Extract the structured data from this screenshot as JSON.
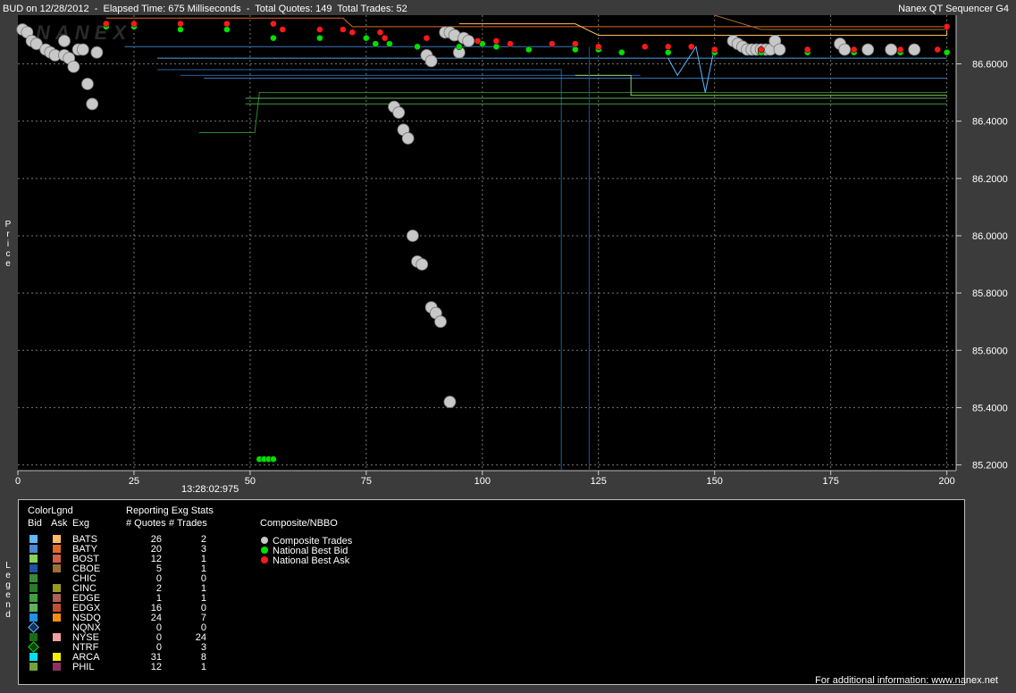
{
  "header": {
    "left": "BUD on 12/28/2012  -  Elapsed Time: 675 Milliseconds  -  Total Quotes: 149  Total Trades: 52",
    "right": "Nanex QT Sequencer G4",
    "watermark": "NANEX"
  },
  "price_axis_label": "Price",
  "legend_side_label": "Legend",
  "time_label": "13:28:02:975",
  "chart_data": {
    "type": "scatter",
    "title": "",
    "xlabel": "",
    "ylabel": "Price",
    "xlim": [
      0,
      202
    ],
    "ylim": [
      85.18,
      86.77
    ],
    "x_ticks": [
      0,
      25,
      50,
      75,
      100,
      125,
      150,
      175,
      200
    ],
    "y_ticks": [
      85.2,
      85.4,
      85.6,
      85.8,
      86.0,
      86.2,
      86.4,
      86.6
    ],
    "y_tick_labels": [
      "85.2000",
      "85.4000",
      "85.6000",
      "85.8000",
      "86.0000",
      "86.2000",
      "86.4000",
      "86.6000"
    ],
    "grid": true,
    "series": [
      {
        "name": "Composite Trades",
        "color": "#c8c8c8",
        "points": [
          [
            1,
            86.72
          ],
          [
            2,
            86.71
          ],
          [
            3,
            86.68
          ],
          [
            4,
            86.67
          ],
          [
            6,
            86.65
          ],
          [
            7,
            86.64
          ],
          [
            8,
            86.63
          ],
          [
            10,
            86.68
          ],
          [
            10,
            86.63
          ],
          [
            11,
            86.62
          ],
          [
            12,
            86.59
          ],
          [
            13,
            86.65
          ],
          [
            14,
            86.65
          ],
          [
            15,
            86.53
          ],
          [
            16,
            86.46
          ],
          [
            17,
            86.64
          ],
          [
            81,
            86.45
          ],
          [
            82,
            86.43
          ],
          [
            83,
            86.37
          ],
          [
            84,
            86.34
          ],
          [
            85,
            86.0
          ],
          [
            86,
            85.91
          ],
          [
            87,
            85.9
          ],
          [
            88,
            86.63
          ],
          [
            89,
            86.61
          ],
          [
            89,
            85.75
          ],
          [
            90,
            85.73
          ],
          [
            91,
            85.7
          ],
          [
            92,
            86.71
          ],
          [
            93,
            86.71
          ],
          [
            93,
            85.42
          ],
          [
            94,
            86.7
          ],
          [
            95,
            86.64
          ],
          [
            96,
            86.69
          ],
          [
            97,
            86.68
          ],
          [
            154,
            86.68
          ],
          [
            155,
            86.67
          ],
          [
            156,
            86.66
          ],
          [
            157,
            86.65
          ],
          [
            158,
            86.65
          ],
          [
            159,
            86.65
          ],
          [
            160,
            86.65
          ],
          [
            161,
            86.65
          ],
          [
            162,
            86.65
          ],
          [
            163,
            86.68
          ],
          [
            164,
            86.65
          ],
          [
            177,
            86.67
          ],
          [
            178,
            86.65
          ],
          [
            183,
            86.65
          ],
          [
            188,
            86.65
          ],
          [
            193,
            86.65
          ]
        ]
      },
      {
        "name": "National Best Bid",
        "color": "#00e000",
        "points": [
          [
            19,
            86.73
          ],
          [
            25,
            86.73
          ],
          [
            35,
            86.72
          ],
          [
            45,
            86.72
          ],
          [
            55,
            86.69
          ],
          [
            65,
            86.69
          ],
          [
            75,
            86.69
          ],
          [
            77,
            86.67
          ],
          [
            80,
            86.67
          ],
          [
            86,
            86.66
          ],
          [
            95,
            86.66
          ],
          [
            100,
            86.67
          ],
          [
            103,
            86.66
          ],
          [
            110,
            86.65
          ],
          [
            120,
            86.65
          ],
          [
            125,
            86.65
          ],
          [
            130,
            86.64
          ],
          [
            140,
            86.64
          ],
          [
            150,
            86.64
          ],
          [
            160,
            86.64
          ],
          [
            170,
            86.64
          ],
          [
            180,
            86.64
          ],
          [
            190,
            86.64
          ],
          [
            200,
            86.64
          ],
          [
            52,
            85.22
          ],
          [
            53,
            85.22
          ],
          [
            54,
            85.22
          ],
          [
            55,
            85.22
          ]
        ]
      },
      {
        "name": "National Best Ask",
        "color": "#ff1a1a",
        "points": [
          [
            19,
            86.74
          ],
          [
            25,
            86.74
          ],
          [
            35,
            86.74
          ],
          [
            45,
            86.74
          ],
          [
            55,
            86.74
          ],
          [
            57,
            86.72
          ],
          [
            65,
            86.72
          ],
          [
            70,
            86.72
          ],
          [
            72,
            86.71
          ],
          [
            78,
            86.71
          ],
          [
            79,
            86.69
          ],
          [
            88,
            86.69
          ],
          [
            99,
            86.68
          ],
          [
            103,
            86.68
          ],
          [
            106,
            86.67
          ],
          [
            115,
            86.67
          ],
          [
            120,
            86.67
          ],
          [
            125,
            86.66
          ],
          [
            135,
            86.66
          ],
          [
            140,
            86.66
          ],
          [
            145,
            86.66
          ],
          [
            150,
            86.65
          ],
          [
            160,
            86.65
          ],
          [
            170,
            86.65
          ],
          [
            180,
            86.65
          ],
          [
            190,
            86.65
          ],
          [
            198,
            86.65
          ],
          [
            200,
            86.73
          ]
        ]
      }
    ]
  },
  "legend": {
    "headers": {
      "colorlgnd": "ColorLgnd",
      "bid": "Bid",
      "ask": "Ask",
      "exg": "Exg",
      "reporting": "Reporting Exg Stats",
      "quotes": "# Quotes",
      "trades": "# Trades",
      "composite": "Composite/NBBO"
    },
    "rows": [
      {
        "exg": "BATS",
        "quotes": "26",
        "trades": "2",
        "bid_color": "#5fb8ff",
        "ask_color": "#ffbb66"
      },
      {
        "exg": "BATY",
        "quotes": "20",
        "trades": "3",
        "bid_color": "#4a8ad0",
        "ask_color": "#e06a2a"
      },
      {
        "exg": "BOST",
        "quotes": "12",
        "trades": "1",
        "bid_color": "#8ad060",
        "ask_color": "#d0604a"
      },
      {
        "exg": "CBOE",
        "quotes": "5",
        "trades": "1",
        "bid_color": "#2050a0",
        "ask_color": "#a07030"
      },
      {
        "exg": "CHIC",
        "quotes": "0",
        "trades": "0",
        "bid_color": "#3a8a3a",
        "ask_color": ""
      },
      {
        "exg": "CINC",
        "quotes": "2",
        "trades": "1",
        "bid_color": "#2a7a2a",
        "ask_color": "#9a9a20"
      },
      {
        "exg": "EDGE",
        "quotes": "1",
        "trades": "1",
        "bid_color": "#40a040",
        "ask_color": "#b06050"
      },
      {
        "exg": "EDGX",
        "quotes": "16",
        "trades": "0",
        "bid_color": "#60b060",
        "ask_color": "#c05030"
      },
      {
        "exg": "NSDQ",
        "quotes": "24",
        "trades": "7",
        "bid_color": "#2090e0",
        "ask_color": "#f09010"
      },
      {
        "exg": "NQNX",
        "quotes": "0",
        "trades": "0",
        "bid_color": "diamond-blue",
        "ask_color": ""
      },
      {
        "exg": "NYSE",
        "quotes": "0",
        "trades": "24",
        "bid_color": "#1a6a1a",
        "ask_color": "#f0a0a0"
      },
      {
        "exg": "NTRF",
        "quotes": "0",
        "trades": "3",
        "bid_color": "diamond-green",
        "ask_color": ""
      },
      {
        "exg": "ARCA",
        "quotes": "31",
        "trades": "8",
        "bid_color": "#00e0f0",
        "ask_color": "#f0f000"
      },
      {
        "exg": "PHIL",
        "quotes": "12",
        "trades": "1",
        "bid_color": "#70a040",
        "ask_color": "#903060"
      }
    ],
    "composite_items": [
      {
        "label": "Composite Trades",
        "color": "#c8c8c8"
      },
      {
        "label": "National Best Bid",
        "color": "#00e000"
      },
      {
        "label": "National Best Ask",
        "color": "#ff1a1a"
      }
    ]
  },
  "footer": "For additional information: www.nanex.net"
}
